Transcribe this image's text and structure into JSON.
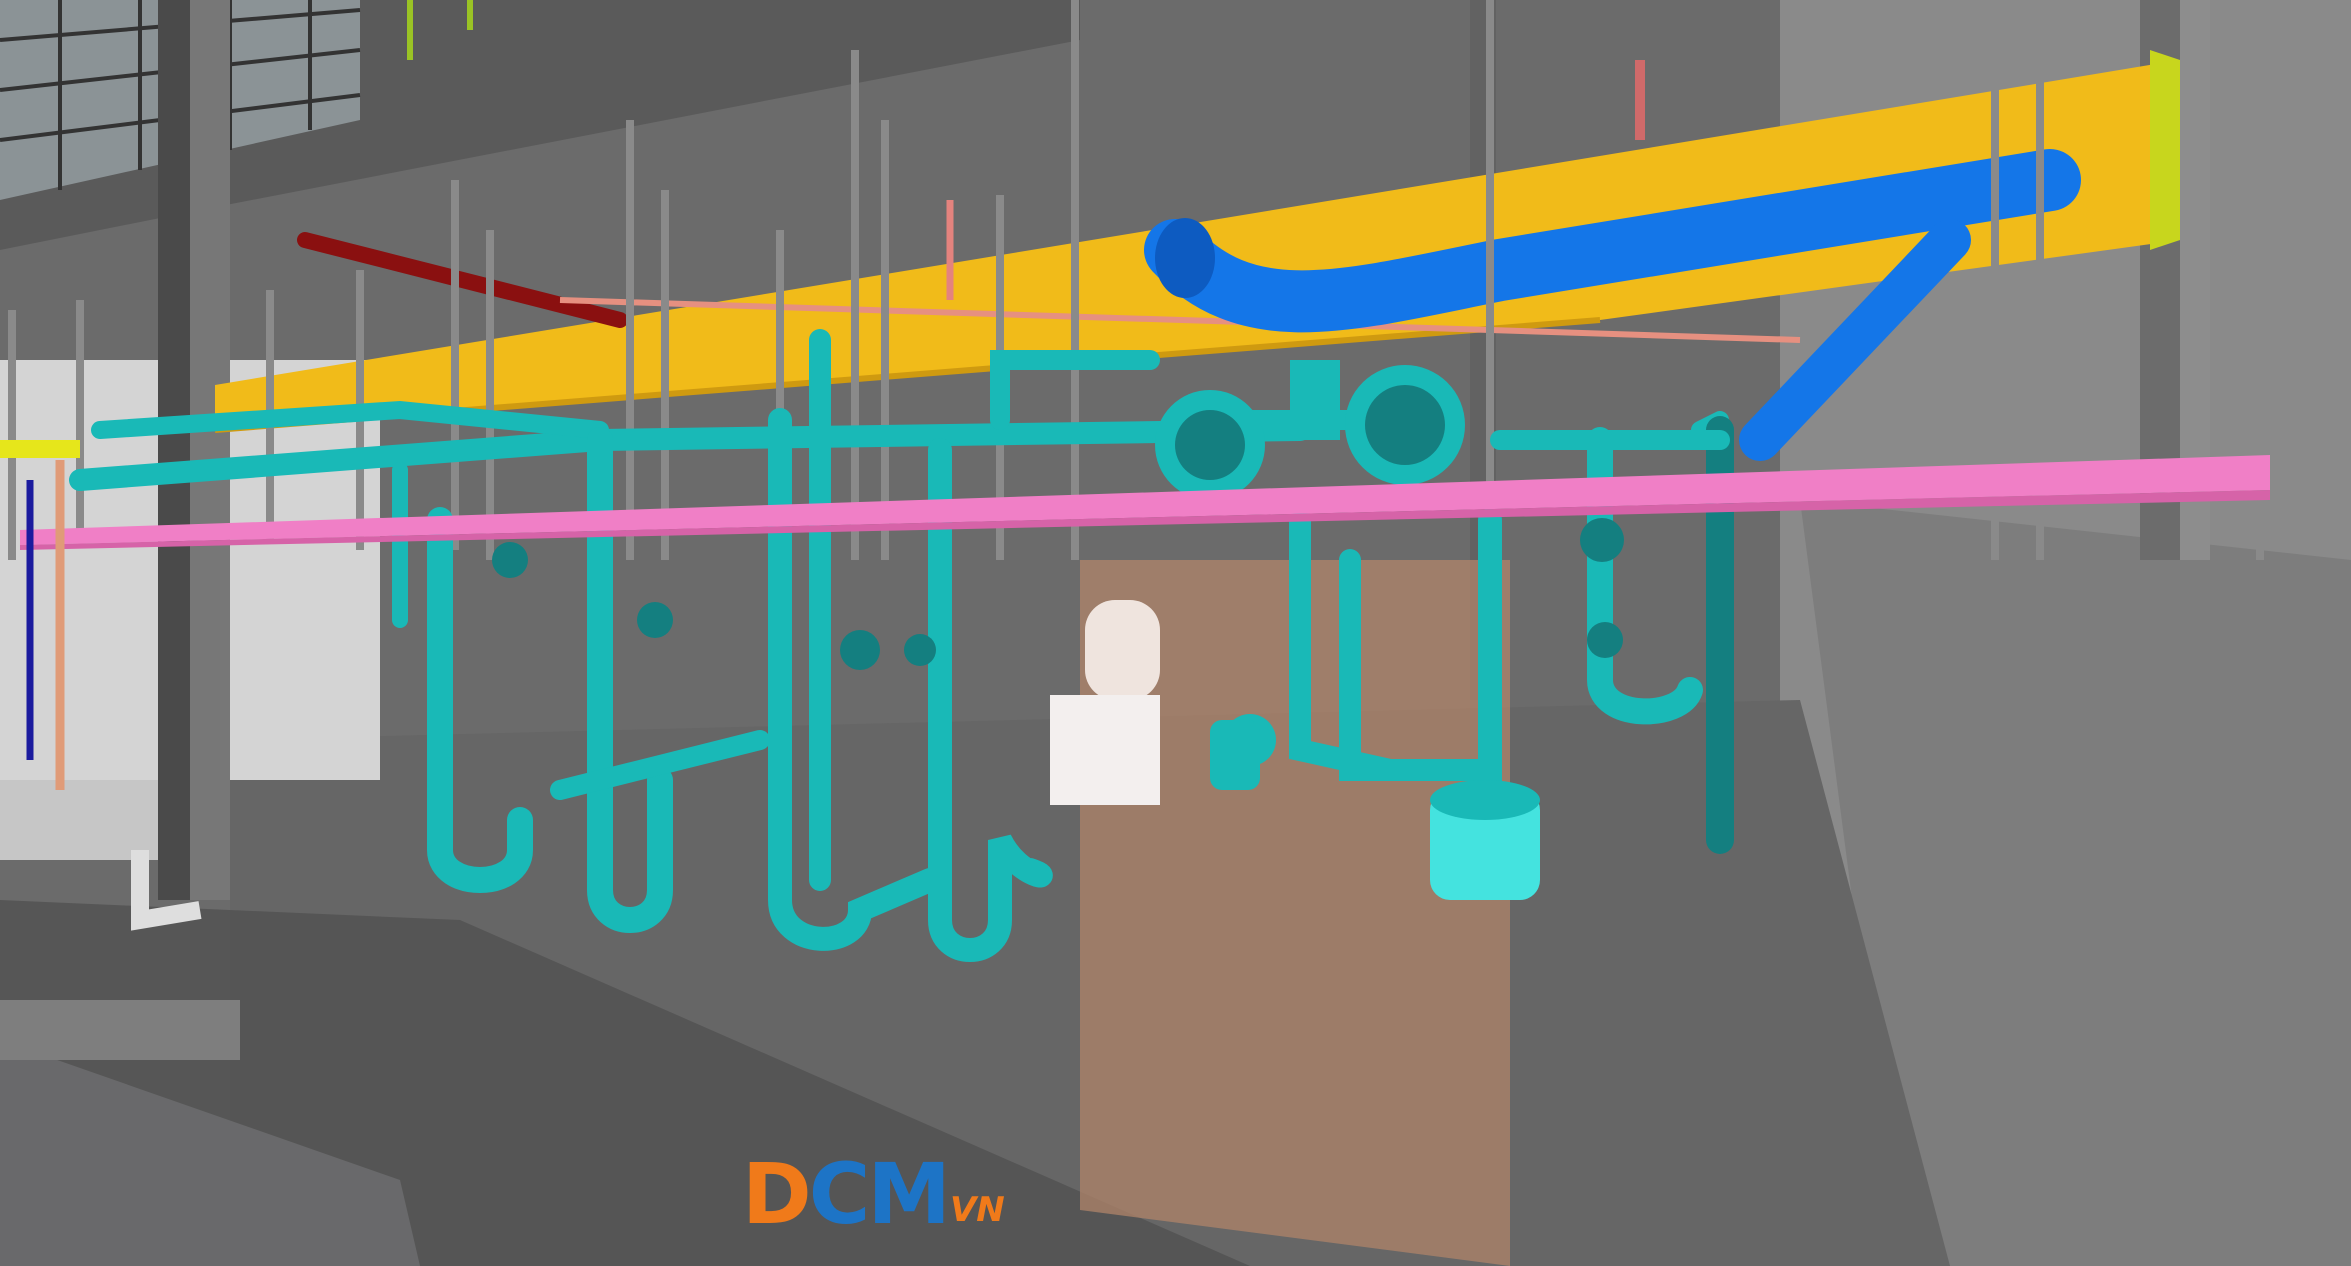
{
  "watermark": {
    "brand_letters_1": "D",
    "brand_letters_2": "CM",
    "brand_suffix": "VN",
    "colors": {
      "orange": "#f07a1a",
      "blue": "#1d74c6"
    }
  },
  "scene_colors": {
    "concrete_dark": "#4b4b4b",
    "concrete_mid": "#777777",
    "concrete_light": "#9d9d9d",
    "cable_tray_yellow": "#f1bb19",
    "pink_tray": "#f07fc6",
    "cyan_pipe": "#19b9b7",
    "cyan_light": "#44e3df",
    "blue_duct": "#1476e8",
    "red_pipe": "#8a1010",
    "tank_white": "#efe4de"
  },
  "icons": [
    "logo-icon"
  ]
}
